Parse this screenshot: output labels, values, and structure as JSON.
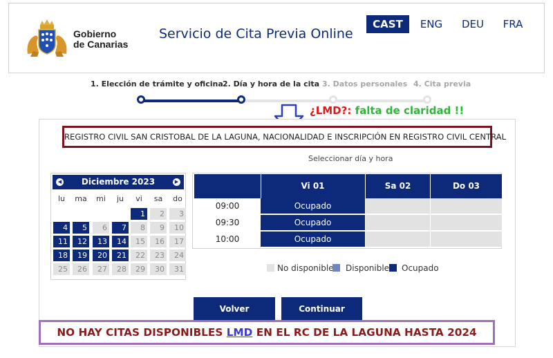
{
  "header": {
    "brand_line1": "Gobierno",
    "brand_line2": "de Canarias",
    "title": "Servicio de Cita Previa Online",
    "languages": [
      {
        "code": "CAST",
        "active": true
      },
      {
        "code": "ENG",
        "active": false
      },
      {
        "code": "DEU",
        "active": false
      },
      {
        "code": "FRA",
        "active": false
      }
    ]
  },
  "steps": [
    {
      "label": "1. Elección de trámite y oficina",
      "state": "done"
    },
    {
      "label": "2. Día y hora de la cita",
      "state": "current"
    },
    {
      "label": "3. Datos personales",
      "state": "pending"
    },
    {
      "label": "4. Cita previa",
      "state": "pending"
    }
  ],
  "annotation_top": {
    "part1": "¿LMD?:",
    "part2": "falta de claridad !!"
  },
  "office": "REGISTRO CIVIL SAN CRISTOBAL DE LA LAGUNA, NACIONALIDAD E INSCRIPCIÓN EN REGISTRO CIVIL CENTRAL",
  "select_label": "Seleccionar día y hora",
  "calendar": {
    "month": "Diciembre 2023",
    "prev_icon": "chevron-left-icon",
    "next_icon": "chevron-right-icon",
    "weekdays": [
      "lu",
      "ma",
      "mi",
      "ju",
      "vi",
      "sa",
      "do"
    ],
    "weeks": [
      [
        null,
        null,
        null,
        null,
        {
          "d": "1",
          "s": "b"
        },
        {
          "d": "2",
          "s": "g"
        },
        {
          "d": "3",
          "s": "g"
        }
      ],
      [
        {
          "d": "4",
          "s": "b"
        },
        {
          "d": "5",
          "s": "b"
        },
        {
          "d": "6",
          "s": "g"
        },
        {
          "d": "7",
          "s": "b"
        },
        {
          "d": "8",
          "s": "g"
        },
        {
          "d": "9",
          "s": "g"
        },
        {
          "d": "10",
          "s": "g"
        }
      ],
      [
        {
          "d": "11",
          "s": "b"
        },
        {
          "d": "12",
          "s": "b"
        },
        {
          "d": "13",
          "s": "b"
        },
        {
          "d": "14",
          "s": "b"
        },
        {
          "d": "15",
          "s": "g"
        },
        {
          "d": "16",
          "s": "g"
        },
        {
          "d": "17",
          "s": "g"
        }
      ],
      [
        {
          "d": "18",
          "s": "b"
        },
        {
          "d": "19",
          "s": "b"
        },
        {
          "d": "20",
          "s": "b"
        },
        {
          "d": "21",
          "s": "b"
        },
        {
          "d": "22",
          "s": "g"
        },
        {
          "d": "23",
          "s": "g"
        },
        {
          "d": "24",
          "s": "g"
        }
      ],
      [
        {
          "d": "25",
          "s": "g"
        },
        {
          "d": "26",
          "s": "g"
        },
        {
          "d": "27",
          "s": "g"
        },
        {
          "d": "28",
          "s": "g"
        },
        {
          "d": "29",
          "s": "g"
        },
        {
          "d": "30",
          "s": "g"
        },
        {
          "d": "31",
          "s": "g"
        }
      ]
    ]
  },
  "schedule": {
    "days": [
      "Vi 01",
      "Sa 02",
      "Do 03"
    ],
    "times": [
      "09:00",
      "09:30",
      "10:00"
    ],
    "slot_label": "Ocupado"
  },
  "legend": {
    "not_available": "No disponible",
    "available": "Disponible",
    "occupied": "Ocupado",
    "colors": {
      "not_available": "#e2e2e2",
      "available": "#6d86bf",
      "occupied": "#0d2a7a"
    }
  },
  "buttons": {
    "back": "Volver",
    "continue": "Continuar"
  },
  "annotation_bottom": {
    "before": "NO HAY CITAS DISPONIBLES",
    "lmd": "LMD",
    "after": "EN EL RC DE LA LAGUNA HASTA 2024"
  },
  "colors": {
    "primary": "#0d2a7a",
    "annotation_red": "#d81b1b",
    "annotation_green": "#2fb53a",
    "office_border": "#7a1420",
    "bottom_border": "#a070b8"
  }
}
